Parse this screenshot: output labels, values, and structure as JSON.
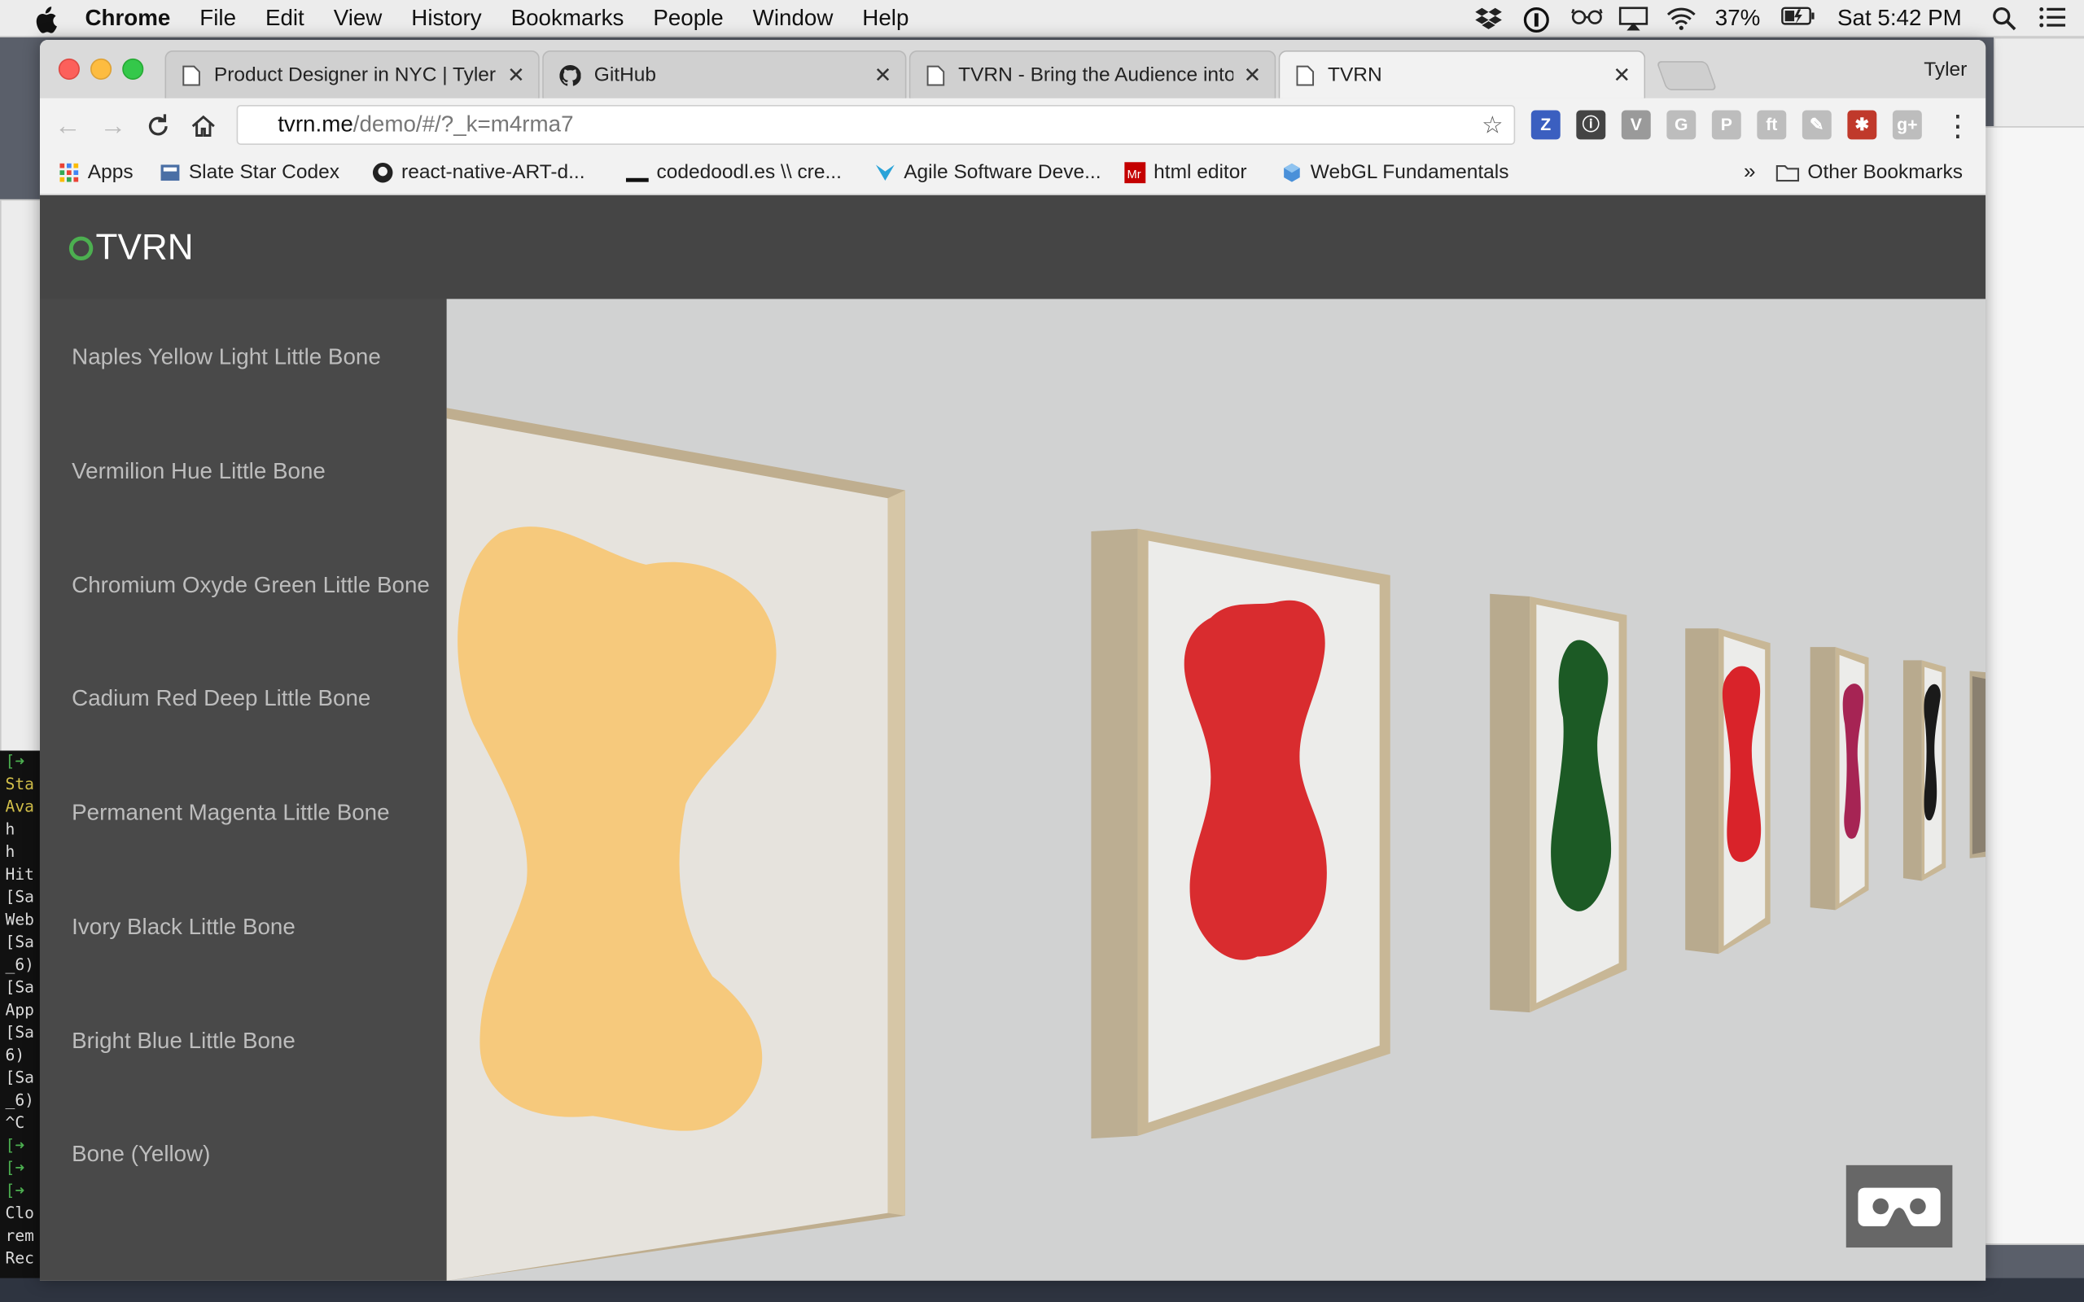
{
  "menubar": {
    "apple_icon": "apple-icon",
    "items": [
      "Chrome",
      "File",
      "Edit",
      "View",
      "History",
      "Bookmarks",
      "People",
      "Window",
      "Help"
    ],
    "battery": "37%",
    "clock": "Sat 5:42 PM"
  },
  "browser": {
    "profile_name": "Tyler",
    "tabs": [
      {
        "title": "Product Designer in NYC | Tyler",
        "icon": "page-icon",
        "active": false
      },
      {
        "title": "GitHub",
        "icon": "github-icon",
        "active": false
      },
      {
        "title": "TVRN - Bring the Audience into",
        "icon": "page-icon",
        "active": false
      },
      {
        "title": "TVRN",
        "icon": "page-icon",
        "active": true
      }
    ],
    "url": {
      "host": "tvrn.me",
      "path": "/demo/#/?_k=m4rma7"
    },
    "extensions": [
      {
        "icon": "z-extension-icon",
        "label": "Z",
        "color": "#3b5fc0"
      },
      {
        "icon": "onepassword-icon",
        "label": "ⓘ",
        "color": "#444444"
      },
      {
        "icon": "v-extension-icon",
        "label": "V",
        "color": "#9a9a9a"
      },
      {
        "icon": "g-extension-icon",
        "label": "G",
        "color": "#bdbdbd"
      },
      {
        "icon": "p-extension-icon",
        "label": "P",
        "color": "#bdbdbd"
      },
      {
        "icon": "feedly-icon",
        "label": "ft",
        "color": "#bdbdbd"
      },
      {
        "icon": "paint-extension-icon",
        "label": "✎",
        "color": "#bdbdbd"
      },
      {
        "icon": "bug-extension-icon",
        "label": "✱",
        "color": "#c0392b"
      },
      {
        "icon": "google-plus-icon",
        "label": "g+",
        "color": "#bdbdbd"
      }
    ],
    "bookmarks": [
      {
        "label": "Apps",
        "icon": "apps-grid-icon"
      },
      {
        "label": "Slate Star Codex",
        "icon": "slate-star-codex-icon"
      },
      {
        "label": "react-native-ART-d...",
        "icon": "github-icon"
      },
      {
        "label": "codedoodl.es \\\\ cre...",
        "icon": "codedoodles-icon"
      },
      {
        "label": "Agile Software Deve...",
        "icon": "agile-icon"
      },
      {
        "label": "html editor",
        "icon": "html-editor-icon"
      },
      {
        "label": "WebGL Fundamentals",
        "icon": "webgl-icon"
      }
    ],
    "overflow_chevron": "»",
    "other_bookmarks": "Other Bookmarks"
  },
  "app": {
    "brand": "TVRN",
    "artworks": [
      "Naples Yellow Light Little Bone",
      "Vermilion Hue Little Bone",
      "Chromium Oxyde Green Little Bone",
      "Cadium Red Deep Little Bone",
      "Permanent Magenta Little Bone",
      "Ivory Black Little Bone",
      "Bright Blue Little Bone",
      "Bone (Yellow)"
    ],
    "vr_button_icon": "cardboard-vr-icon",
    "colors": {
      "accent": "#4caf50",
      "header_bg": "#454545",
      "sidebar_bg": "#4a4a4a",
      "scene_bg": "#d1d2d2",
      "frame": "#c8b796"
    },
    "painting_colors": [
      "#f6c97c",
      "#d92c2f",
      "#1c5a25",
      "#d9232a",
      "#a62454",
      "#1a1a1a",
      "#8a8070"
    ]
  },
  "terminal": {
    "lines": [
      "[➜",
      "Sta",
      "Ava",
      "  h",
      "  h",
      "Hit",
      "[Sa",
      "Web",
      "[Sa",
      "_6)",
      "[Sa",
      "App",
      "[Sa",
      "6) ",
      "[Sa",
      "_6)",
      "^C",
      "[➜",
      "[➜",
      "[➜",
      "Clo",
      "rem",
      "Rec"
    ]
  }
}
